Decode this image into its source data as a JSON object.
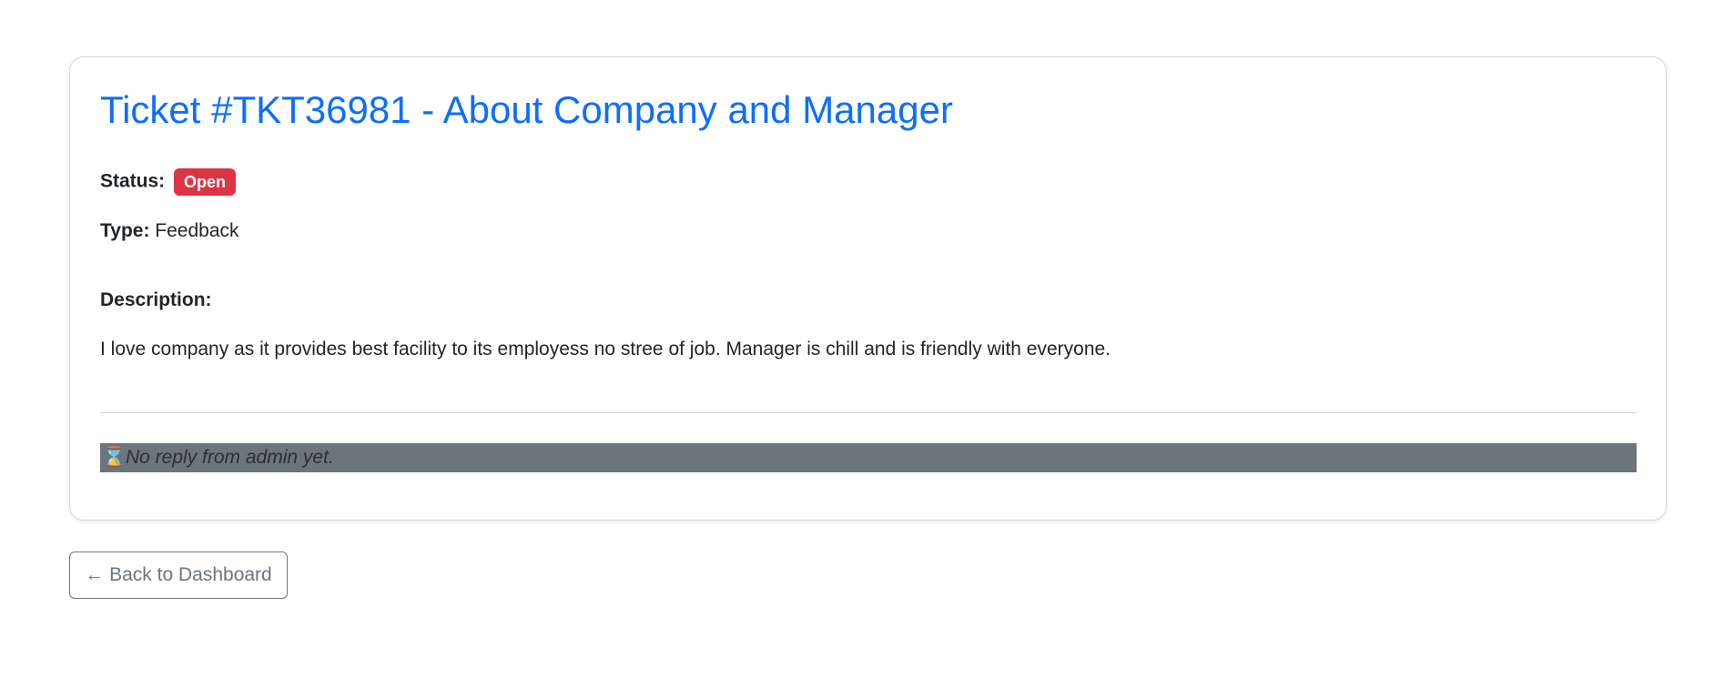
{
  "ticket": {
    "title": "Ticket #TKT36981 - About Company and Manager",
    "status_label": "Status:",
    "status_value": "Open",
    "status_color": "#dc3545",
    "type_label": "Type:",
    "type_value": "Feedback",
    "description_label": "Description:",
    "description_text": "I love company as it provides best facility to its employess no stree of job. Manager is chill and is friendly with everyone.",
    "reply_icon": "⌛",
    "reply_text": "No reply from admin yet."
  },
  "navigation": {
    "back_label": "← Back to Dashboard"
  },
  "colors": {
    "accent": "#0d6efd",
    "danger": "#dc3545",
    "secondary": "#6c757d"
  }
}
